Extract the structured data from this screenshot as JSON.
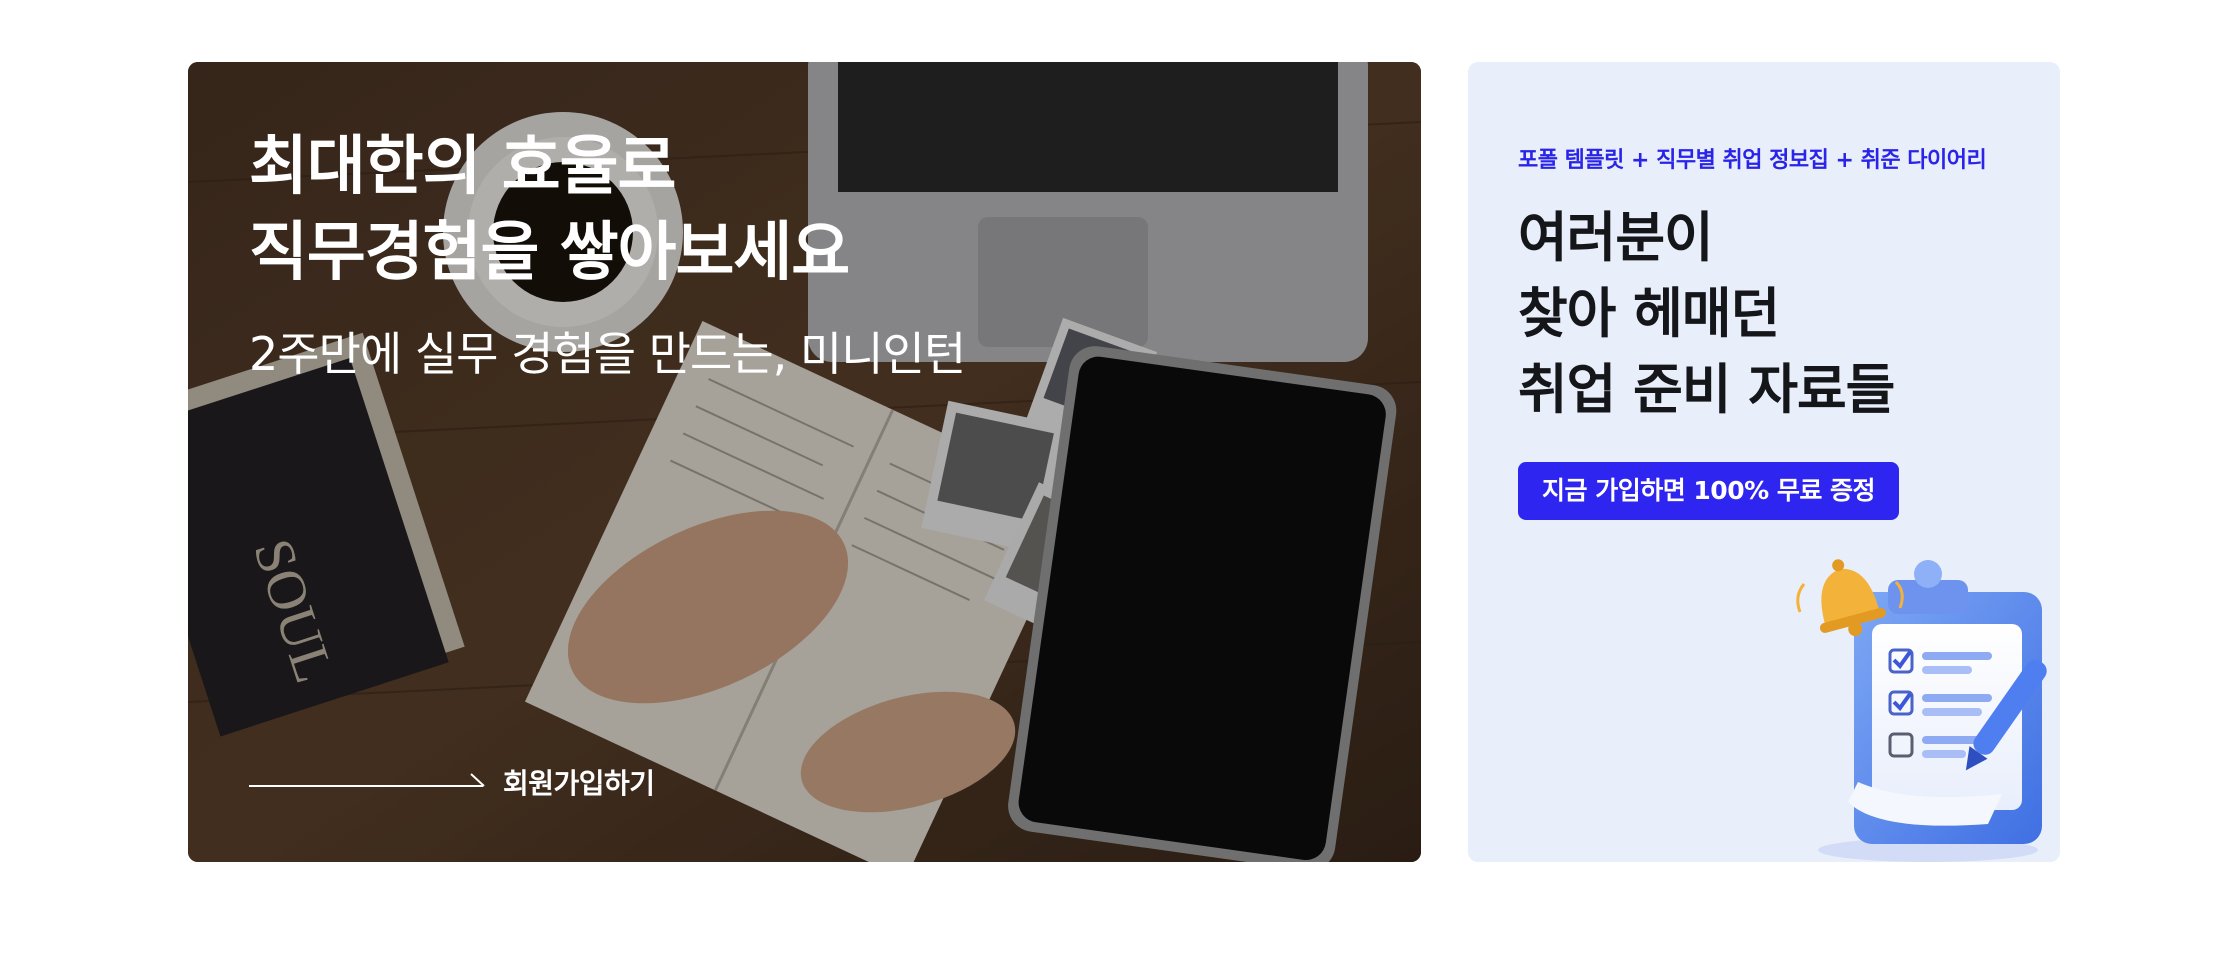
{
  "hero": {
    "title_line1": "최대한의 효율로",
    "title_line2": "직무경험을 쌓아보세요",
    "subtitle": "2주만에 실무 경험을 만드는, 미니인턴",
    "cta_label": "회원가입하기",
    "photo_icon": "desk-workspace-photo",
    "arrow_icon": "long-arrow-right-icon"
  },
  "promo": {
    "eyebrow": "포폴 템플릿 + 직무별 취업 정보집 + 취준 다이어리",
    "title_line1": "여러분이",
    "title_line2": "찾아 헤매던",
    "title_line3": "취업 준비 자료들",
    "badge_label": "지금 가입하면 100% 무료 증정",
    "illustration_icon": "clipboard-checklist-bell-icon",
    "colors": {
      "accent": "#2f25f1",
      "background": "#e9eefb",
      "title": "#15161a"
    }
  }
}
